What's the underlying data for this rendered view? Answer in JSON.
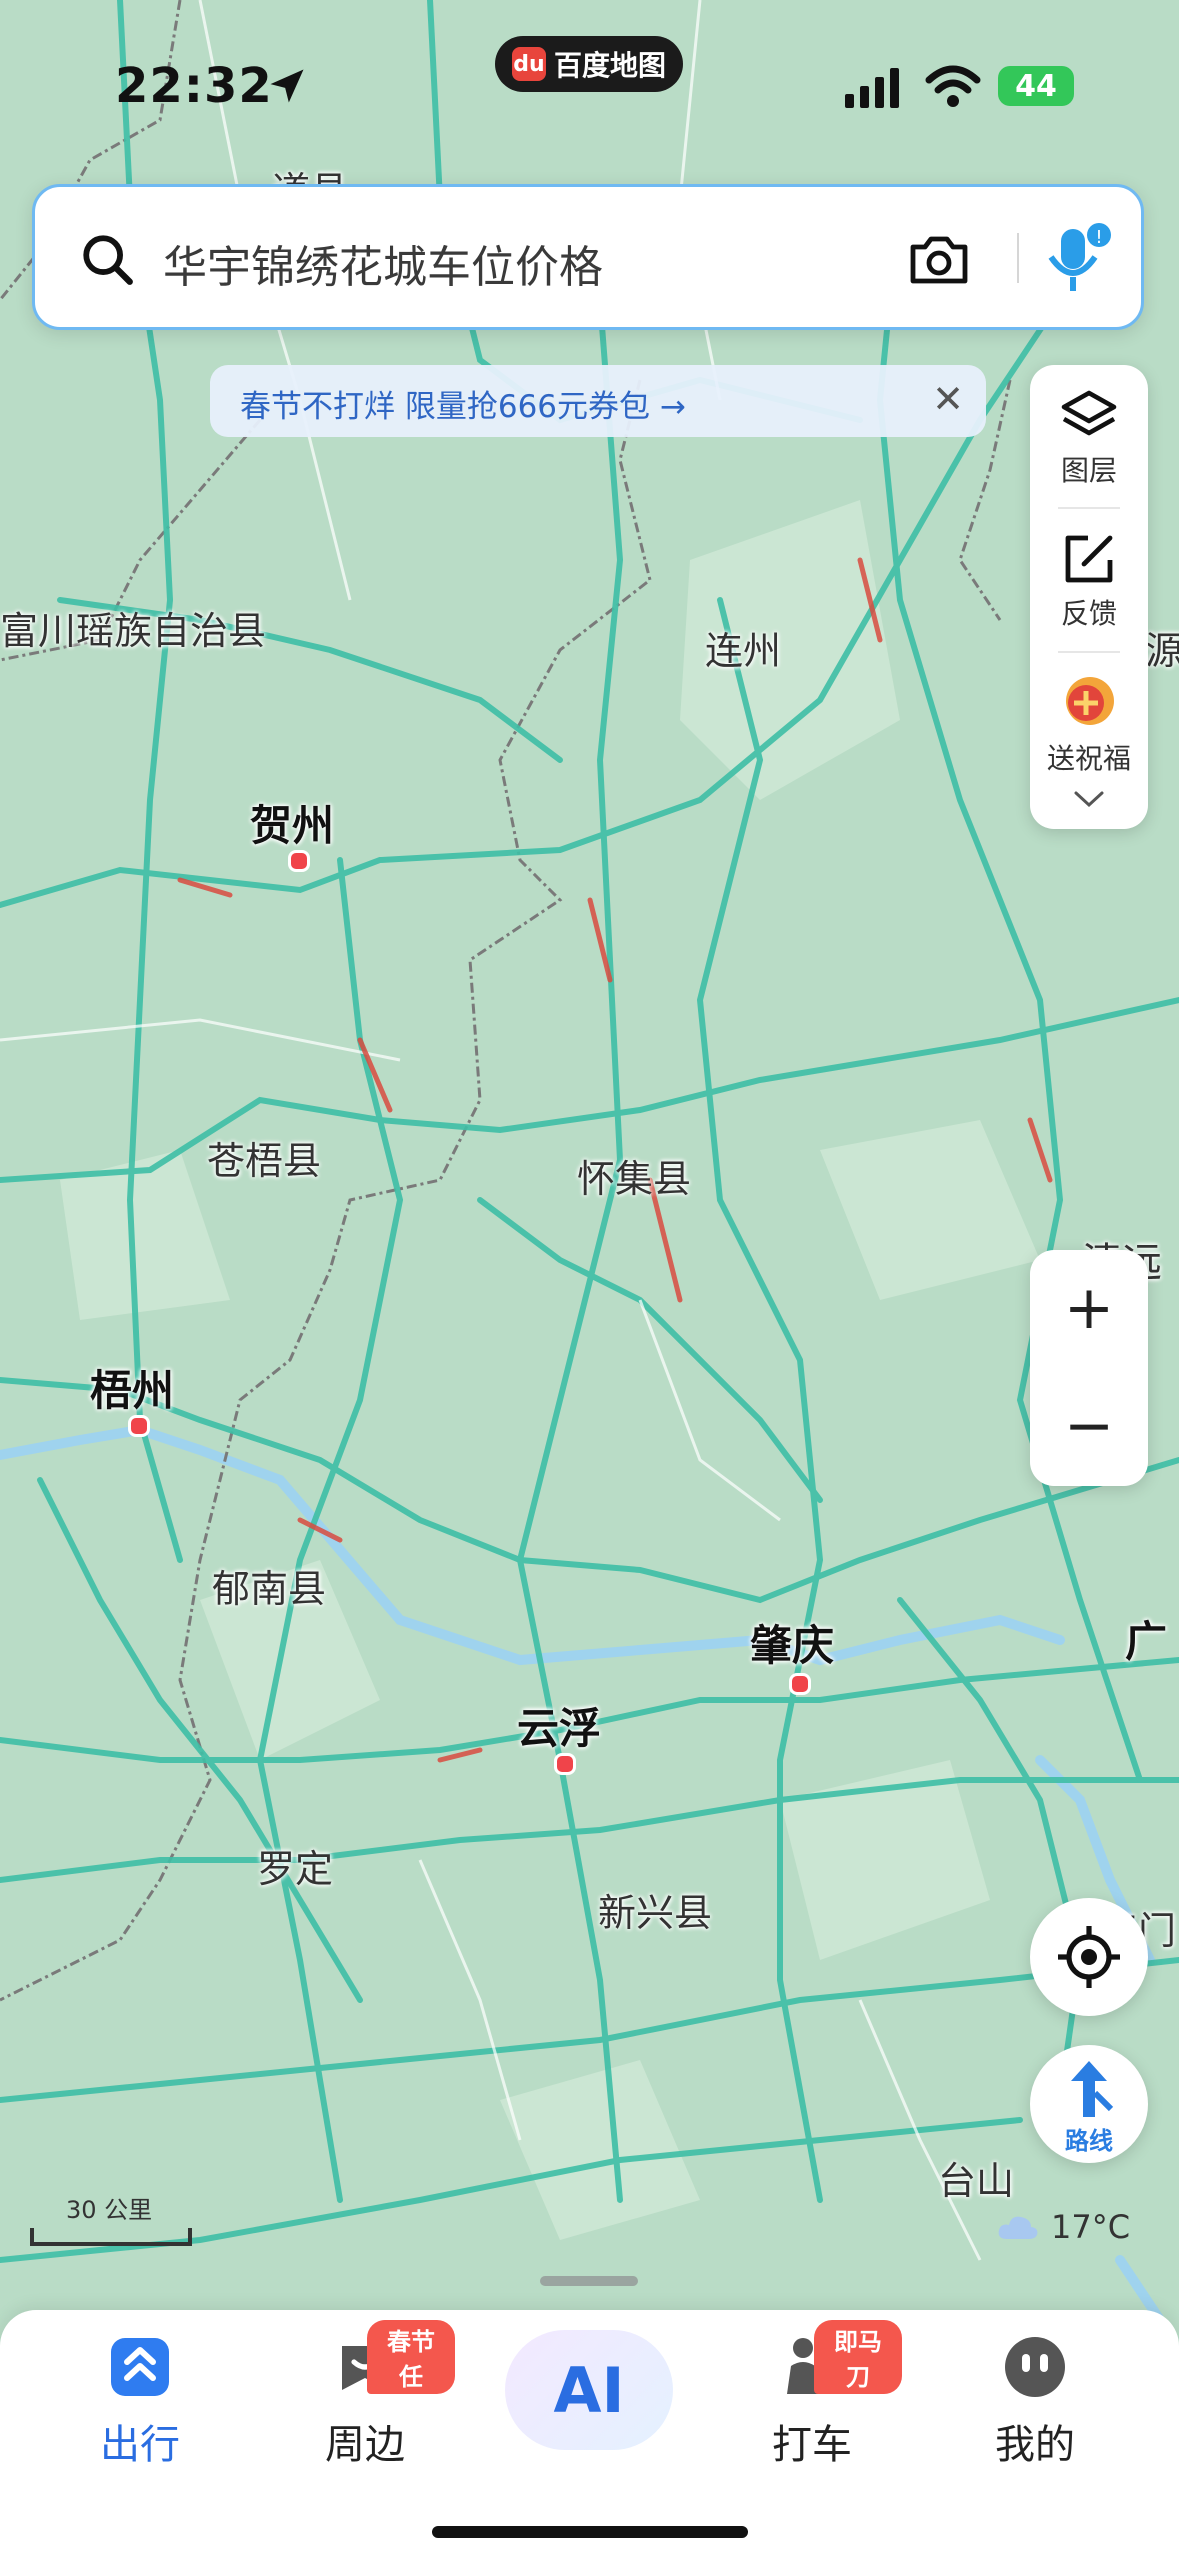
{
  "status_bar": {
    "time": "22:32",
    "app_name": "百度地图",
    "battery": "44"
  },
  "search": {
    "placeholder": "华宇锦绣花城车位价格"
  },
  "promo": {
    "text": "春节不打烊 限量抢666元券包 →",
    "close": "✕"
  },
  "tools": {
    "layers": "图层",
    "feedback": "反馈",
    "blessing": "送祝福"
  },
  "zoom": {
    "in": "+",
    "out": "−"
  },
  "route": {
    "label": "路线"
  },
  "scale": {
    "label": "30 公里"
  },
  "weather": {
    "temp": "17°C"
  },
  "map_labels": {
    "daoxian": "道县",
    "fuchuan": "富川瑶族自治县",
    "lianzhou": "连州",
    "hezhou": "贺州",
    "cangwu": "苍梧县",
    "huaiji": "怀集县",
    "qingyuan": "清远",
    "wuzhou": "梧州",
    "yunan": "郁南县",
    "zhaoqing": "肇庆",
    "guang": "广",
    "yunfu": "云浮",
    "luoding": "罗定",
    "xinxing": "新兴县",
    "jiangmen": "江门",
    "taishan": "台山",
    "yuan": "源"
  },
  "bottom_nav": {
    "items": [
      {
        "label": "出行",
        "active": true
      },
      {
        "label": "周边",
        "badge": "春节任"
      },
      {
        "label": "AI"
      },
      {
        "label": "打车",
        "badge": "即马刀"
      },
      {
        "label": "我的"
      }
    ]
  },
  "colors": {
    "accent": "#2a6de1",
    "map_bg": "#b9dcc6",
    "road": "#3fbfa6",
    "border": "#7a7a7a",
    "city_dot": "#f0444a"
  }
}
